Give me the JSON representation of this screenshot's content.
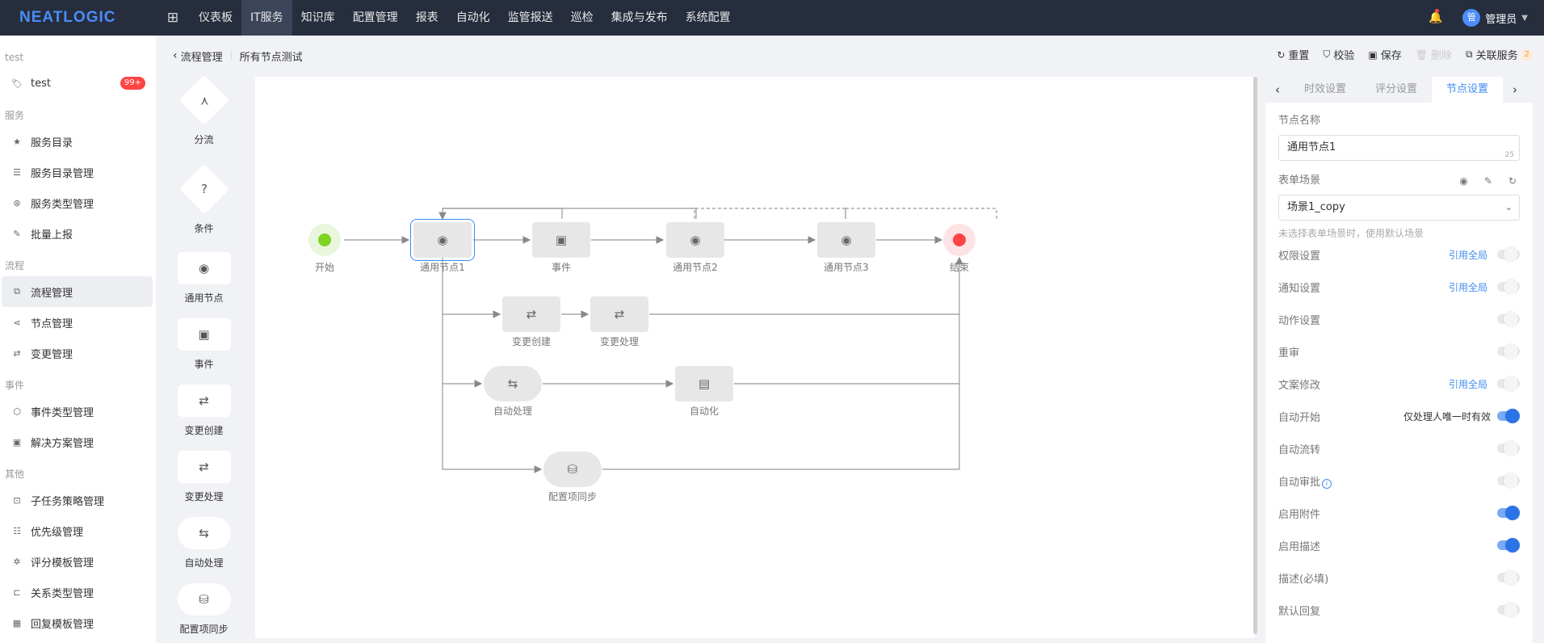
{
  "app": {
    "logo": "NEATLOGIC",
    "apps_icon": "grid-icon"
  },
  "nav": {
    "items": [
      "仪表板",
      "IT服务",
      "知识库",
      "配置管理",
      "报表",
      "自动化",
      "监管报送",
      "巡检",
      "集成与发布",
      "系统配置"
    ],
    "active": "IT服务"
  },
  "user": {
    "avatar": "管",
    "name": "管理员"
  },
  "sidebar": {
    "g0": "test",
    "test": {
      "label": "test",
      "badge": "99+"
    },
    "g1": "服务",
    "s1": [
      "服务目录",
      "服务目录管理",
      "服务类型管理",
      "批量上报"
    ],
    "g2": "流程",
    "s2": [
      "流程管理",
      "节点管理",
      "变更管理"
    ],
    "g3": "事件",
    "s3": [
      "事件类型管理",
      "解决方案管理"
    ],
    "g4": "其他",
    "s4": [
      "子任务策略管理",
      "优先级管理",
      "评分模板管理",
      "关系类型管理",
      "回复模板管理"
    ]
  },
  "breadcrumb": {
    "parent": "流程管理",
    "current": "所有节点测试"
  },
  "actions": {
    "reset": "重置",
    "validate": "校验",
    "save": "保存",
    "delete": "删除",
    "related": "关联服务",
    "related_count": "2"
  },
  "palette": [
    "分流",
    "条件",
    "通用节点",
    "事件",
    "变更创建",
    "变更处理",
    "自动处理",
    "配置项同步"
  ],
  "palette_glyphs": {
    "split": "⋏",
    "condition": "?",
    "general": "◉",
    "event": "▣",
    "change_create": "⇄",
    "change_handle": "⇄",
    "auto": "⇆",
    "config_sync": "⛁"
  },
  "flow": {
    "start": "开始",
    "general1": "通用节点1",
    "event": "事件",
    "general2": "通用节点2",
    "general3": "通用节点3",
    "end": "结束",
    "change_create": "变更创建",
    "change_handle": "变更处理",
    "auto_handle": "自动处理",
    "automation": "自动化",
    "config_sync": "配置项同步"
  },
  "panel": {
    "tabs": [
      "时效设置",
      "评分设置",
      "节点设置"
    ],
    "active_tab": "节点设置",
    "node_name_label": "节点名称",
    "node_name_value": "通用节点1",
    "node_name_count": "25",
    "form_scene_label": "表单场景",
    "form_scene_value": "场景1_copy",
    "form_scene_hint": "未选择表单场景时，使用默认场景",
    "rows": [
      {
        "label": "权限设置",
        "link": "引用全局",
        "on": false
      },
      {
        "label": "通知设置",
        "link": "引用全局",
        "on": false
      },
      {
        "label": "动作设置",
        "on": false
      },
      {
        "label": "重审",
        "on": false
      },
      {
        "label": "文案修改",
        "link": "引用全局",
        "on": false
      },
      {
        "label": "自动开始",
        "text": "仅处理人唯一时有效",
        "on": true
      },
      {
        "label": "自动流转",
        "on": false
      },
      {
        "label": "自动审批",
        "info": true,
        "on": false
      },
      {
        "label": "启用附件",
        "on": true
      },
      {
        "label": "启用描述",
        "on": true
      },
      {
        "label": "描述(必填)",
        "on": false
      },
      {
        "label": "默认回复",
        "on": false
      }
    ]
  },
  "colors": {
    "accent": "#3f8cf1",
    "topbar": "#262d3d",
    "start": "#7ed321",
    "end": "#f44"
  }
}
